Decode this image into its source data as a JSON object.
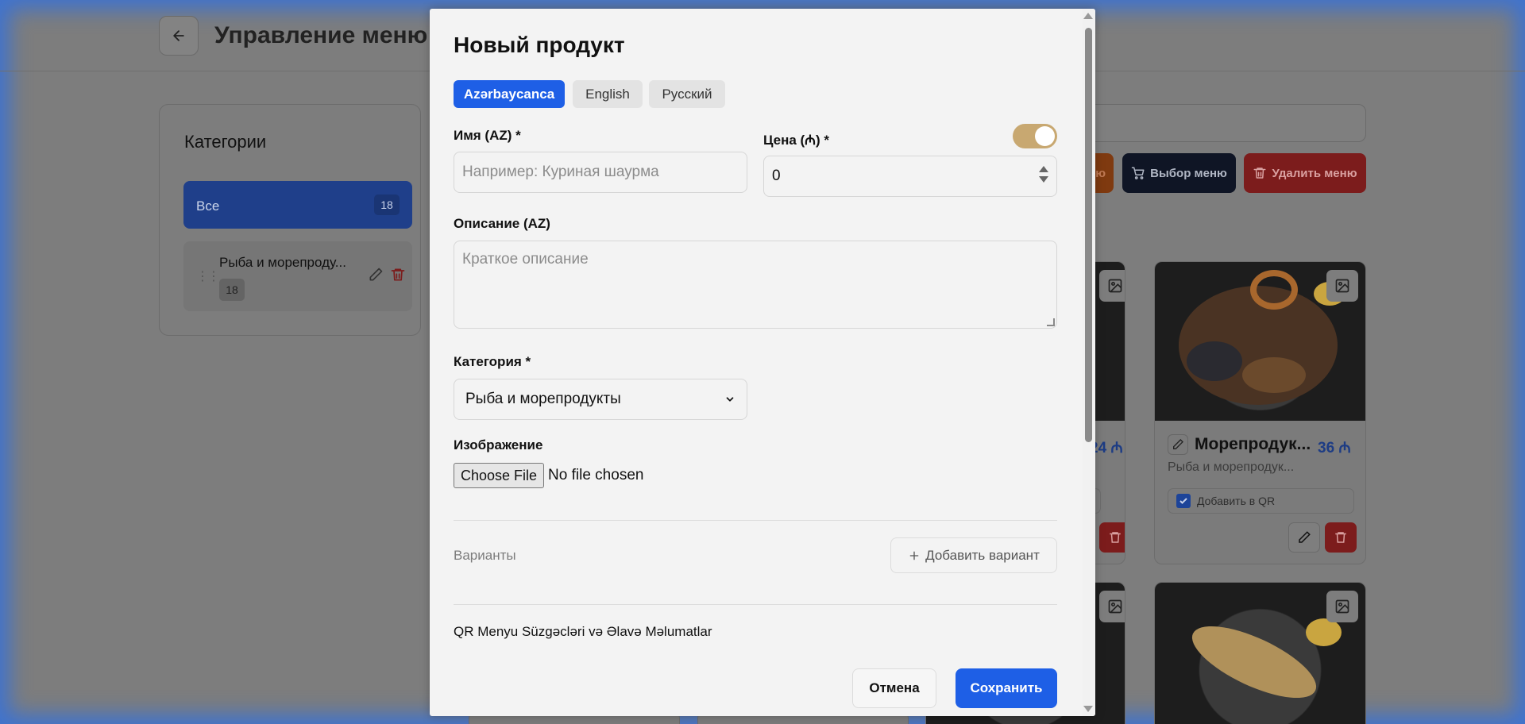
{
  "background": {
    "page_title": "Управление меню",
    "categories_panel": {
      "title": "Категории",
      "all_label": "Все",
      "all_count": "18",
      "items": [
        {
          "label": "Рыба и морепроду...",
          "count": "18"
        }
      ]
    },
    "toolbar": {
      "orange_label": "ю",
      "select_menu_label": "Выбор меню",
      "delete_menu_label": "Удалить меню"
    },
    "cards": [
      {
        "price_partial": "24 ₼"
      },
      {
        "name": "Морепродук...",
        "price": "36 ₼",
        "category": "Рыба и морепродук...",
        "qr_label": "Добавить в QR",
        "qr_checked": true
      }
    ]
  },
  "modal": {
    "title": "Новый продукт",
    "language_tabs": [
      {
        "label": "Azərbaycanca",
        "active": true
      },
      {
        "label": "English",
        "active": false
      },
      {
        "label": "Русский",
        "active": false
      }
    ],
    "name_label": "Имя (AZ) *",
    "name_placeholder": "Например: Куриная шаурма",
    "name_value": "",
    "price_label": "Цена (₼) *",
    "price_value": "0",
    "toggle_on": true,
    "description_label": "Описание (AZ)",
    "description_placeholder": "Краткое описание",
    "category_label": "Категория *",
    "category_value": "Рыба и морепродукты",
    "image_label": "Изображение",
    "file_button": "Choose File",
    "file_status": "No file chosen",
    "variants_label": "Варианты",
    "add_variant_label": "Добавить вариант",
    "qr_filters_label": "QR Menyu Süzgəcləri və Əlavə Məlumatlar",
    "cancel_label": "Отмена",
    "save_label": "Сохранить"
  },
  "colors": {
    "accent_blue": "#1e5fe6",
    "toggle_gold": "#c8a871",
    "danger_red": "#dc2626"
  }
}
